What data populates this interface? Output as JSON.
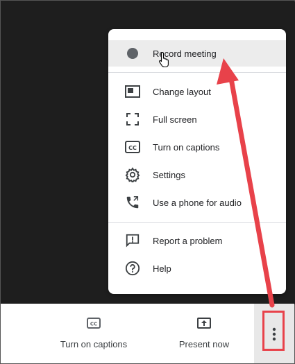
{
  "menu": {
    "items": [
      {
        "label": "Record meeting",
        "icon": "record-dot-icon"
      },
      {
        "label": "Change layout",
        "icon": "layout-icon"
      },
      {
        "label": "Full screen",
        "icon": "fullscreen-icon"
      },
      {
        "label": "Turn on captions",
        "icon": "closed-captions-icon"
      },
      {
        "label": "Settings",
        "icon": "gear-icon"
      },
      {
        "label": "Use a phone for audio",
        "icon": "phone-icon"
      },
      {
        "label": "Report a problem",
        "icon": "report-icon"
      },
      {
        "label": "Help",
        "icon": "help-icon"
      }
    ]
  },
  "bottom_bar": {
    "captions_label": "Turn on captions",
    "present_label": "Present now"
  },
  "colors": {
    "annotation_red": "#e8424a",
    "icon_gray": "#5f6368",
    "highlight": "#ececec"
  }
}
